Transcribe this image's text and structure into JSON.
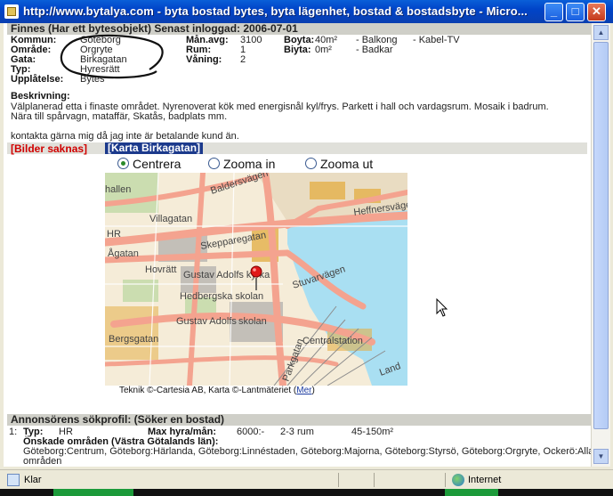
{
  "window": {
    "title": "http://www.bytalya.com - byta bostad bytes, byta lägenhet, bostad & bostadsbyte - Micro..."
  },
  "listing": {
    "header": "Finnes (Har ett bytesobjekt) Senast inloggad: 2006-07-01",
    "fields": {
      "kommun_label": "Kommun:",
      "kommun": "Göteborg",
      "omrade_label": "Område:",
      "omrade": "Orgryte",
      "gata_label": "Gata:",
      "gata": "Birkagatan",
      "typ_label": "Typ:",
      "typ": "Hyresrätt",
      "upplatelse_label": "Upplåtelse:",
      "upplatelse": "Bytes",
      "manavg_label": "Mån.avg:",
      "manavg": "3100",
      "rum_label": "Rum:",
      "rum": "1",
      "vaning_label": "Våning:",
      "vaning": "2",
      "boyta_label": "Boyta:",
      "boyta": "40m²",
      "biyta_label": "Biyta:",
      "biyta": "0m²",
      "extra1": "- Balkong",
      "extra2": "- Badkar",
      "extra3": "- Kabel-TV"
    },
    "beskrivning_label": "Beskrivning:",
    "beskrivning_line1": "Välplanerad etta i finaste området. Nyrenoverat kök med energisnål kyl/frys. Parkett i hall och vardagsrum. Mosaik i badrum.",
    "beskrivning_line2": "Nära till spårvagn, mataffär, Skatås, badplats mm.",
    "kontakt": "kontakta gärna mig då jag inte är betalande kund än."
  },
  "tabs": {
    "bilder": "[Bilder saknas]",
    "karta": "[Karta Birkagatan]"
  },
  "map_controls": {
    "centrera": "Centrera",
    "zooma_in": "Zooma in",
    "zooma_ut": "Zooma ut"
  },
  "map_labels": {
    "baldersvagen": "Baldersvägen",
    "villagatan": "Villagatan",
    "hallen": "hallen",
    "hr": "HR",
    "agatan": "Ågatan",
    "skepparegatan": "Skepparegatan",
    "heffnersvagen": "Heffnersvägen",
    "stuvarvagen": "Stuvarvägen",
    "kyrka": "Gustav Adolfs kyrka",
    "skolan": "Hedbergska skolan",
    "gustav": "Gustav Adolfs",
    "skolan2": "skolan",
    "bergsgatan": "Bergsgatan",
    "parkgatan": "Parkgatan",
    "centralstation": "Centralstation",
    "land": "Land",
    "hovratt": "Hovrätt"
  },
  "map_credit": {
    "text": "Teknik ©-Cartesia AB, Karta ©-Lantmäteriet (",
    "link": "Mer",
    "close": ")"
  },
  "profile": {
    "header": "Annonsörens sökprofil: (Söker en bostad)",
    "num": "1:",
    "typ_label": "Typ:",
    "typ": "HR",
    "maxhyra_label": "Max hyra/mån:",
    "maxhyra": "6000:-",
    "rum": "2-3 rum",
    "yta": "45-150m²",
    "omraden_label": "Önskade områden (Västra Götalands län):",
    "omraden_line1": "Göteborg:Centrum, Göteborg:Härlanda, Göteborg:Linnéstaden, Göteborg:Majorna, Göteborg:Styrsö, Göteborg:Orgryte, Ockerö:Alla",
    "omraden_line2": "områden"
  },
  "statusbar": {
    "status": "Klar",
    "zone": "Internet"
  },
  "colors": {
    "titlebar": "#0044c8",
    "section_bg": "#cfcfc8",
    "tab_blue": "#1c3a8c",
    "tab_red": "#d00000",
    "water": "#a9dff2",
    "road": "#f4a38f"
  }
}
